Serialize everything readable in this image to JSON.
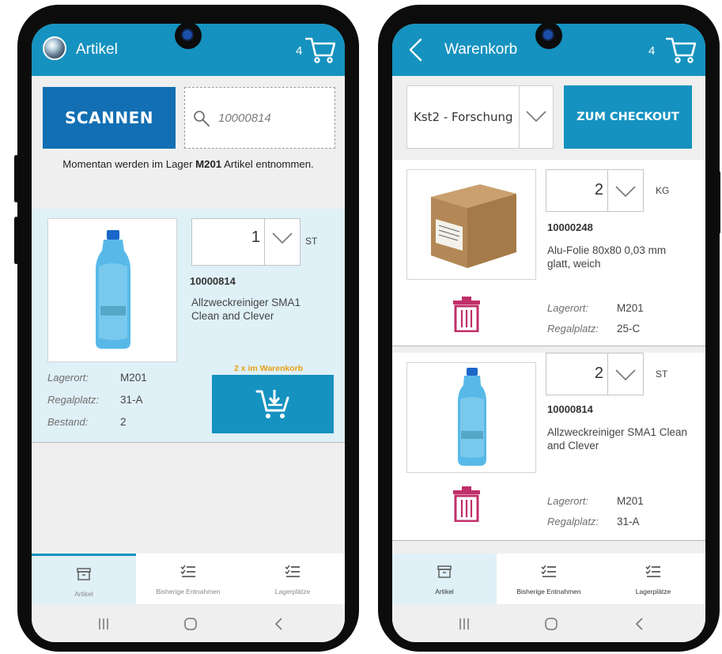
{
  "left_screen": {
    "header": {
      "title": "Artikel",
      "cart_count": "4"
    },
    "scan_button": "SCANNEN",
    "search": {
      "value": "10000814"
    },
    "info": {
      "prefix": "Momentan werden im Lager ",
      "warehouse": "M201",
      "suffix": " Artikel entnommen."
    },
    "item": {
      "quantity": "1",
      "unit": "ST",
      "article_number": "10000814",
      "description_line1": "Allzweckreiniger SMA1",
      "description_line2": "Clean and Clever",
      "lagerort_label": "Lagerort:",
      "lagerort_value": "M201",
      "regalplatz_label": "Regalplatz:",
      "regalplatz_value": "31-A",
      "bestand_label": "Bestand:",
      "bestand_value": "2",
      "in_cart_note": "2 x im Warenkorb"
    },
    "bottom_nav": [
      {
        "label": "Artikel",
        "icon": "archive-icon"
      },
      {
        "label": "Bisherige Entnahmen",
        "icon": "checklist-icon"
      },
      {
        "label": "Lagerplätze",
        "icon": "checklist-icon"
      }
    ]
  },
  "right_screen": {
    "header": {
      "title": "Warenkorb",
      "cart_count": "4"
    },
    "cost_center": "Kst2 - Forschung",
    "checkout_button": "ZUM CHECKOUT",
    "items": [
      {
        "quantity": "2",
        "unit": "KG",
        "article_number": "10000248",
        "description_line1": "Alu-Folie 80x80 0,03 mm",
        "description_line2": "glatt, weich",
        "lagerort_label": "Lagerort:",
        "lagerort_value": "M201",
        "regalplatz_label": "Regalplatz:",
        "regalplatz_value": "25-C"
      },
      {
        "quantity": "2",
        "unit": "ST",
        "article_number": "10000814",
        "description_line1": "Allzweckreiniger SMA1 Clean",
        "description_line2": "and Clever",
        "lagerort_label": "Lagerort:",
        "lagerort_value": "M201",
        "regalplatz_label": "Regalplatz:",
        "regalplatz_value": "31-A"
      }
    ],
    "bottom_nav": [
      {
        "label": "Artikel",
        "icon": "archive-icon"
      },
      {
        "label": "Bisherige Entnahmen",
        "icon": "checklist-icon"
      },
      {
        "label": "Lagerplätze",
        "icon": "checklist-icon"
      }
    ]
  },
  "colors": {
    "primary": "#1592bf",
    "scan_blue": "#126fb3",
    "accent_orange": "#e7a117",
    "trash_pink": "#c0306a",
    "panel_bg": "#dff0f7"
  }
}
